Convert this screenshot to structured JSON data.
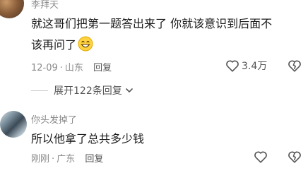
{
  "comment1": {
    "username": "李拜天",
    "text_line1": "就这哥们把第一题答出来了 你就该意识到后面不",
    "text_line2": "该再问了",
    "emoji": "grin-face-emoji",
    "date": "12-09",
    "location": "山东",
    "reply_label": "回复",
    "like_count": "3.4万",
    "like_icon": "heart-outline-icon",
    "dislike_icon": "broken-heart-icon"
  },
  "expand_replies": {
    "label": "展开122条回复",
    "icon": "chevron-down-icon"
  },
  "comment2": {
    "username": "你头发掉了",
    "text": "所以他拿了总共多少钱",
    "time": "刚刚",
    "location": "广东",
    "reply_label": "回复",
    "like_icon": "heart-outline-icon",
    "dislike_icon": "broken-heart-icon"
  },
  "colors": {
    "text_primary": "#1a1a1a",
    "text_secondary": "#8a8a8a",
    "icon": "#555555"
  }
}
